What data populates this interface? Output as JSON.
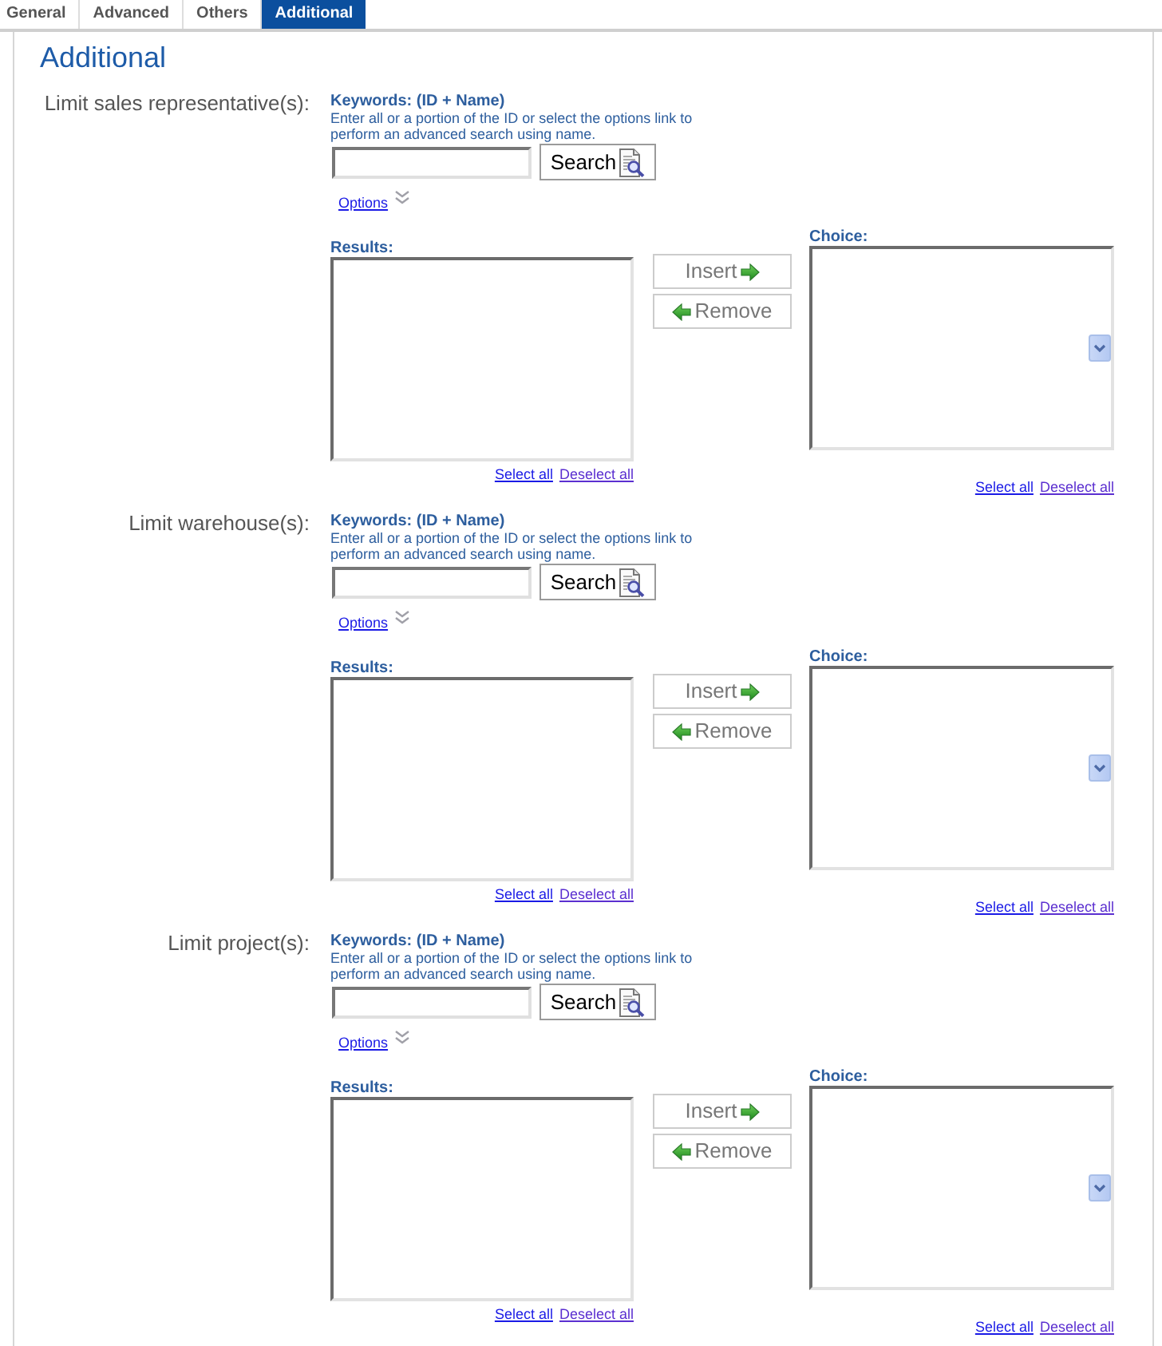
{
  "tabs": [
    {
      "label": "General",
      "selected": false
    },
    {
      "label": "Advanced",
      "selected": false
    },
    {
      "label": "Others",
      "selected": false
    },
    {
      "label": "Additional",
      "selected": true
    }
  ],
  "panel": {
    "title": "Additional"
  },
  "sections": [
    {
      "label": "Limit sales representative(s):",
      "keywords": {
        "label": "Keywords: (ID + Name)",
        "help": "Enter all or a portion of the ID or select the options link to perform an advanced search using name."
      },
      "search_button": "Search",
      "options_link": "Options",
      "results": {
        "label": "Results:",
        "links": [
          {
            "label": "Select all",
            "visited": false
          },
          {
            "label": "Deselect all",
            "visited": true
          }
        ]
      },
      "insert_button": "Insert",
      "remove_button": "Remove",
      "choice": {
        "label": "Choice:",
        "links": [
          {
            "label": "Select all",
            "visited": false
          },
          {
            "label": "Deselect all",
            "visited": true
          }
        ]
      }
    },
    {
      "label": "Limit warehouse(s):",
      "keywords": {
        "label": "Keywords: (ID + Name)",
        "help": "Enter all or a portion of the ID or select the options link to perform an advanced search using name."
      },
      "search_button": "Search",
      "options_link": "Options",
      "results": {
        "label": "Results:",
        "links": [
          {
            "label": "Select all",
            "visited": false
          },
          {
            "label": "Deselect all",
            "visited": true
          }
        ]
      },
      "insert_button": "Insert",
      "remove_button": "Remove",
      "choice": {
        "label": "Choice:",
        "links": [
          {
            "label": "Select all",
            "visited": false
          },
          {
            "label": "Deselect all",
            "visited": true
          }
        ]
      }
    },
    {
      "label": "Limit project(s):",
      "keywords": {
        "label": "Keywords: (ID + Name)",
        "help": "Enter all or a portion of the ID or select the options link to perform an advanced search using name."
      },
      "search_button": "Search",
      "options_link": "Options",
      "results": {
        "label": "Results:",
        "links": [
          {
            "label": "Select all",
            "visited": false
          },
          {
            "label": "Deselect all",
            "visited": true
          }
        ]
      },
      "insert_button": "Insert",
      "remove_button": "Remove",
      "choice": {
        "label": "Choice:",
        "links": [
          {
            "label": "Select all",
            "visited": false
          },
          {
            "label": "Deselect all",
            "visited": true
          }
        ]
      }
    }
  ]
}
